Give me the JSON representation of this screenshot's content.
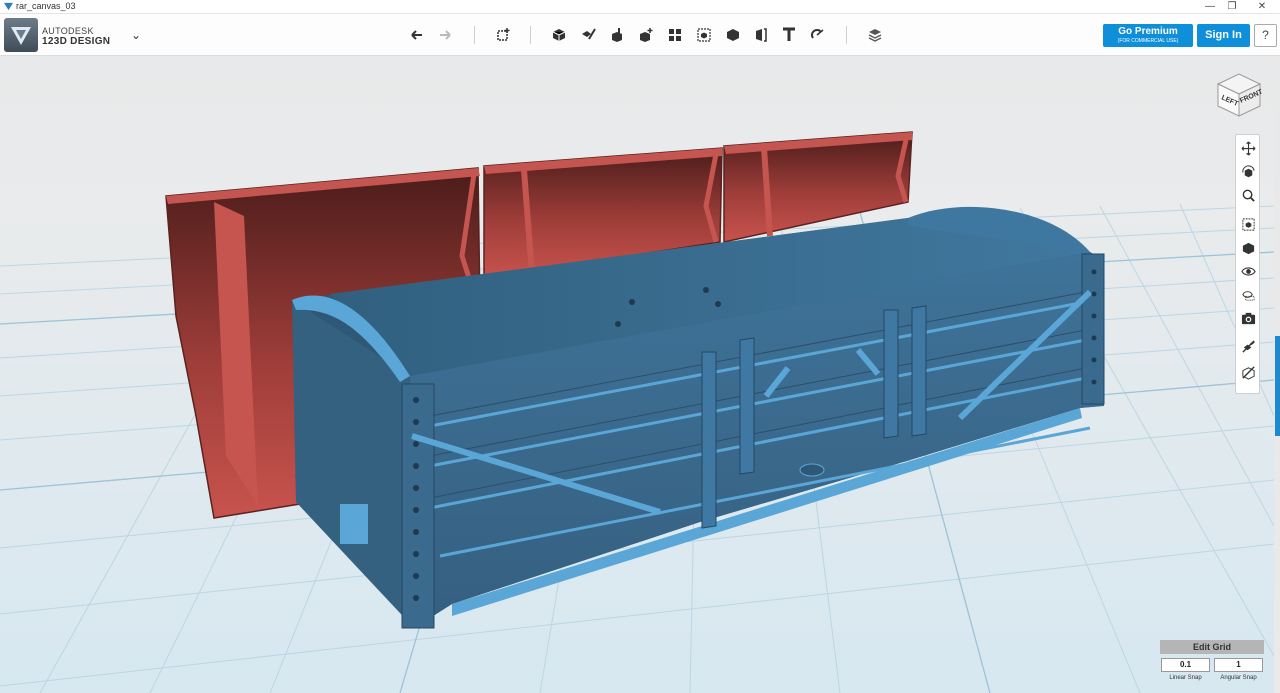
{
  "window": {
    "title": "rar_canvas_03",
    "controls": [
      "—",
      "❐",
      "✕"
    ]
  },
  "brand": {
    "line1": "AUTODESK",
    "line2": "123D DESIGN"
  },
  "toolbar": {
    "app_menu": "⌄",
    "tools": [
      "undo-icon",
      "redo-icon",
      "transform-icon",
      "primitives-icon",
      "sketch-icon",
      "construct-icon",
      "modify-icon",
      "pattern-icon",
      "group-icon",
      "combine-icon",
      "measure-icon",
      "text-icon",
      "snap-icon",
      "material-icon"
    ]
  },
  "premium": {
    "label": "Go Premium",
    "sublabel": "(FOR COMMERCIAL USE)"
  },
  "signin": {
    "label": "Sign In"
  },
  "help": {
    "label": "?"
  },
  "viewcube": {
    "left_label": "LEFT",
    "front_label": "FRONT"
  },
  "nav": {
    "tools": [
      "pan-icon",
      "orbit-icon",
      "zoom-icon",
      "fit-icon",
      "view-materials-icon",
      "visibility-icon",
      "view-mode-icon",
      "screenshot-icon",
      "hide-sketch-icon",
      "hide-mesh-icon"
    ]
  },
  "grid": {
    "edit_label": "Edit Grid",
    "linear_value": "0.1",
    "angular_value": "1",
    "linear_label": "Linear Snap",
    "angular_label": "Angular Snap"
  },
  "colors": {
    "accent": "#0f8fd9",
    "model_blue": "#3c6d93",
    "model_red": "#b94a45",
    "grid_line": "#b8d4e4"
  }
}
